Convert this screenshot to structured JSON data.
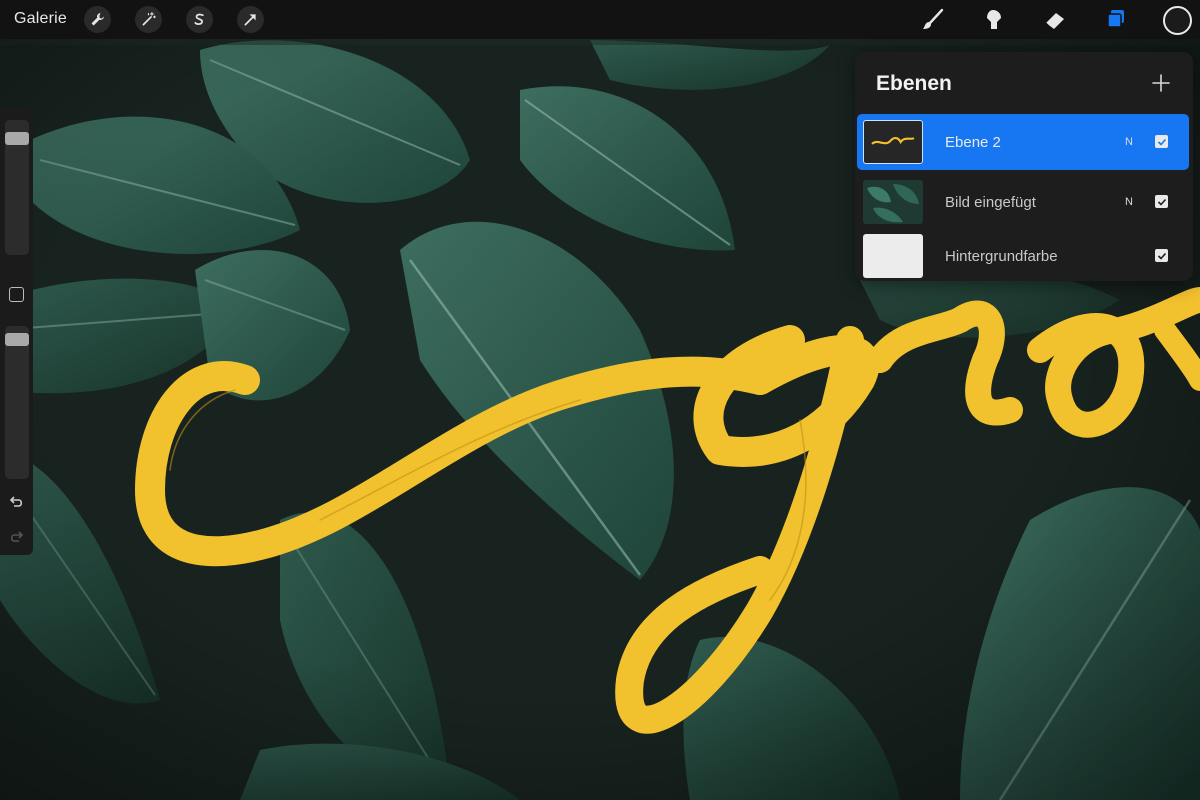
{
  "toolbar": {
    "gallery_label": "Galerie",
    "left_tools": [
      "wrench-icon",
      "magic-wand-icon",
      "selection-icon",
      "transform-arrow-icon"
    ],
    "right_tools": [
      "brush-icon",
      "smudge-icon",
      "eraser-icon",
      "layers-icon"
    ],
    "active_tool": "layers-icon",
    "current_color": "#1b1b1b",
    "accent_color": "#1777f3"
  },
  "sidebar": {
    "brush_size_level": 0.9,
    "opacity_level": 0.95,
    "icons": [
      "modify-square-icon",
      "undo-icon",
      "redo-icon"
    ]
  },
  "layers_panel": {
    "title": "Ebenen",
    "add_icon": "plus-icon",
    "layers": [
      {
        "name": "Ebene 2",
        "blend_mode": "N",
        "visible": true,
        "selected": true,
        "thumbnail": "yellow-lettering"
      },
      {
        "name": "Bild eingefügt",
        "blend_mode": "N",
        "visible": true,
        "selected": false,
        "thumbnail": "leaves-photo"
      },
      {
        "name": "Hintergrundfarbe",
        "blend_mode": "",
        "visible": true,
        "selected": false,
        "thumbnail": "white-fill"
      }
    ]
  },
  "canvas": {
    "lettering_text": "glo",
    "lettering_color": "#f2c12e",
    "background": "dark green leaves photo"
  }
}
